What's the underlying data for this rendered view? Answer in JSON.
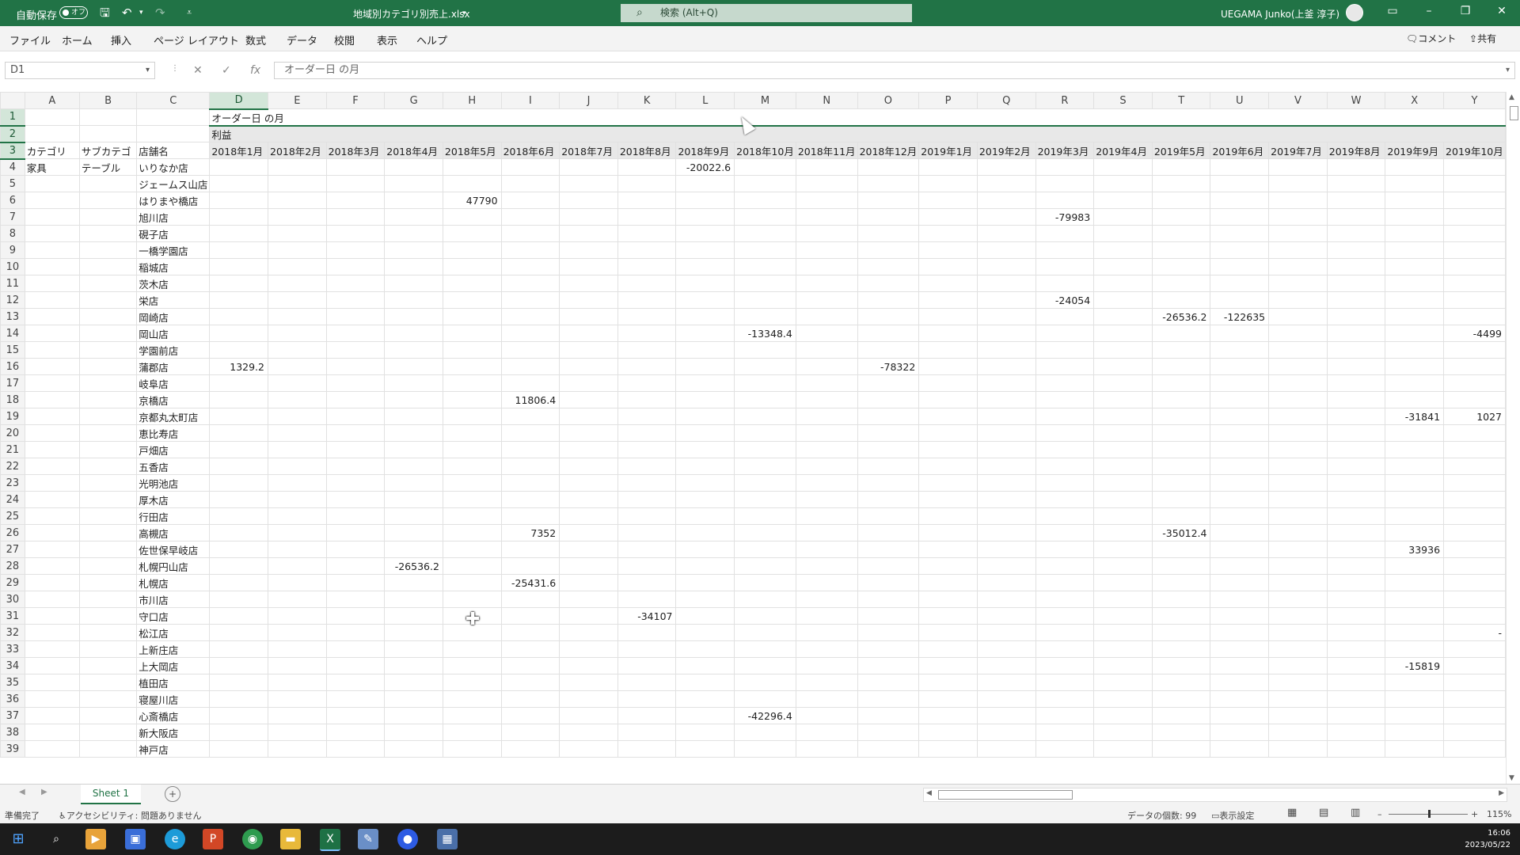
{
  "titlebar": {
    "autosave_label": "自動保存",
    "autosave_state": "オフ",
    "file_name": "地域別カテゴリ別売上.xlsx",
    "search_placeholder": "検索 (Alt+Q)",
    "user_name": "UEGAMA Junko(上釜 淳子)",
    "accent_color": "#217346"
  },
  "menu": {
    "items": [
      "ファイル",
      "ホーム",
      "挿入",
      "ページ レイアウト",
      "数式",
      "データ",
      "校閲",
      "表示",
      "ヘルプ"
    ],
    "comment_label": "コメント",
    "share_label": "共有"
  },
  "formula_bar": {
    "name_box": "D1",
    "formula": "オーダー日 の月"
  },
  "sheet": {
    "col_headers": [
      "A",
      "B",
      "C",
      "D",
      "E",
      "F",
      "G",
      "H",
      "I",
      "J",
      "K",
      "L",
      "M",
      "N",
      "O",
      "P",
      "Q",
      "R",
      "S",
      "T",
      "U",
      "V",
      "W",
      "X",
      "Y"
    ],
    "row1_label": "オーダー日 の月",
    "row2_label": "利益",
    "row3": [
      "カテゴリ",
      "サブカテゴ",
      "店舗名",
      "2018年1月",
      "2018年2月",
      "2018年3月",
      "2018年4月",
      "2018年5月",
      "2018年6月",
      "2018年7月",
      "2018年8月",
      "2018年9月",
      "2018年10月",
      "2018年11月",
      "2018年12月",
      "2019年1月",
      "2019年2月",
      "2019年3月",
      "2019年4月",
      "2019年5月",
      "2019年6月",
      "2019年7月",
      "2019年8月",
      "2019年9月",
      "2019年10月"
    ],
    "rows": [
      {
        "n": "4",
        "a": "家具",
        "b": "テーブル",
        "c": "いりなか店",
        "v": {
          "L": "-20022.6"
        }
      },
      {
        "n": "5",
        "a": "",
        "b": "",
        "c": "ジェームス山店",
        "v": {}
      },
      {
        "n": "6",
        "a": "",
        "b": "",
        "c": "はりまや橋店",
        "v": {
          "H": "47790"
        }
      },
      {
        "n": "7",
        "a": "",
        "b": "",
        "c": "旭川店",
        "v": {
          "R": "-79983"
        }
      },
      {
        "n": "8",
        "a": "",
        "b": "",
        "c": "硯子店",
        "v": {}
      },
      {
        "n": "9",
        "a": "",
        "b": "",
        "c": "一橋学園店",
        "v": {}
      },
      {
        "n": "10",
        "a": "",
        "b": "",
        "c": "稲城店",
        "v": {}
      },
      {
        "n": "11",
        "a": "",
        "b": "",
        "c": "茨木店",
        "v": {}
      },
      {
        "n": "12",
        "a": "",
        "b": "",
        "c": "栄店",
        "v": {
          "R": "-24054"
        }
      },
      {
        "n": "13",
        "a": "",
        "b": "",
        "c": "岡崎店",
        "v": {
          "T": "-26536.2",
          "U": "-122635"
        }
      },
      {
        "n": "14",
        "a": "",
        "b": "",
        "c": "岡山店",
        "v": {
          "M": "-13348.4",
          "Y": "-4499"
        }
      },
      {
        "n": "15",
        "a": "",
        "b": "",
        "c": "学園前店",
        "v": {}
      },
      {
        "n": "16",
        "a": "",
        "b": "",
        "c": "蒲郡店",
        "v": {
          "D": "1329.2",
          "O": "-78322"
        }
      },
      {
        "n": "17",
        "a": "",
        "b": "",
        "c": "岐阜店",
        "v": {}
      },
      {
        "n": "18",
        "a": "",
        "b": "",
        "c": "京橋店",
        "v": {
          "I": "11806.4"
        }
      },
      {
        "n": "19",
        "a": "",
        "b": "",
        "c": "京都丸太町店",
        "v": {
          "X": "-31841",
          "Y": "1027"
        }
      },
      {
        "n": "20",
        "a": "",
        "b": "",
        "c": "恵比寿店",
        "v": {}
      },
      {
        "n": "21",
        "a": "",
        "b": "",
        "c": "戸畑店",
        "v": {}
      },
      {
        "n": "22",
        "a": "",
        "b": "",
        "c": "五香店",
        "v": {}
      },
      {
        "n": "23",
        "a": "",
        "b": "",
        "c": "光明池店",
        "v": {}
      },
      {
        "n": "24",
        "a": "",
        "b": "",
        "c": "厚木店",
        "v": {}
      },
      {
        "n": "25",
        "a": "",
        "b": "",
        "c": "行田店",
        "v": {}
      },
      {
        "n": "26",
        "a": "",
        "b": "",
        "c": "高槻店",
        "v": {
          "I": "7352",
          "T": "-35012.4"
        }
      },
      {
        "n": "27",
        "a": "",
        "b": "",
        "c": "佐世保早岐店",
        "v": {
          "X": "33936"
        }
      },
      {
        "n": "28",
        "a": "",
        "b": "",
        "c": "札幌円山店",
        "v": {
          "G": "-26536.2"
        }
      },
      {
        "n": "29",
        "a": "",
        "b": "",
        "c": "札幌店",
        "v": {
          "I": "-25431.6"
        }
      },
      {
        "n": "30",
        "a": "",
        "b": "",
        "c": "市川店",
        "v": {}
      },
      {
        "n": "31",
        "a": "",
        "b": "",
        "c": "守口店",
        "v": {
          "K": "-34107"
        }
      },
      {
        "n": "32",
        "a": "",
        "b": "",
        "c": "松江店",
        "v": {
          "Y": "-"
        }
      },
      {
        "n": "33",
        "a": "",
        "b": "",
        "c": "上新庄店",
        "v": {}
      },
      {
        "n": "34",
        "a": "",
        "b": "",
        "c": "上大岡店",
        "v": {
          "X": "-15819"
        }
      },
      {
        "n": "35",
        "a": "",
        "b": "",
        "c": "植田店",
        "v": {}
      },
      {
        "n": "36",
        "a": "",
        "b": "",
        "c": "寝屋川店",
        "v": {}
      },
      {
        "n": "37",
        "a": "",
        "b": "",
        "c": "心斎橋店",
        "v": {
          "M": "-42296.4"
        }
      },
      {
        "n": "38",
        "a": "",
        "b": "",
        "c": "新大阪店",
        "v": {}
      },
      {
        "n": "39",
        "a": "",
        "b": "",
        "c": "神戸店",
        "v": {}
      }
    ]
  },
  "tabs": {
    "sheet_name": "Sheet 1"
  },
  "status": {
    "ready": "準備完了",
    "accessibility": "アクセシビリティ: 問題ありません",
    "count": "データの個数: 99",
    "display_settings": "表示設定",
    "zoom": "115%"
  },
  "clock": {
    "time": "16:06",
    "date": "2023/05/22"
  }
}
